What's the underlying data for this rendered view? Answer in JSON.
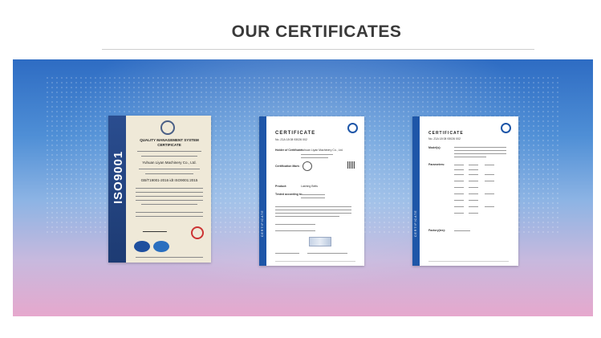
{
  "section": {
    "title": "OUR CERTIFICATES"
  },
  "certificates": [
    {
      "name": "iso-9001",
      "side_text": "ISO9001",
      "heading": "QUALITY MANAGEMENT SYSTEM",
      "subheading": "CERTIFICATE",
      "company": "Yuhuan Liyan Machinery Co., Ltd.",
      "standard": "GB/T19001-2016 idt ISO9001:2015"
    },
    {
      "name": "tuv-certificate-1",
      "side_text": "CERTIFICATE",
      "heading": "CERTIFICATE",
      "number": "No. Z1A 18 08 93026 002",
      "holder_label": "Holder of Certificate:",
      "holder": "Yuhuan Liyan Machinery Co., Ltd.",
      "mark_label": "Certification Mark:",
      "product_label": "Product:",
      "product": "Lashing Belts",
      "tested_label": "Tested according to:"
    },
    {
      "name": "tuv-certificate-2",
      "side_text": "CERTIFICATE",
      "heading": "CERTIFICATE",
      "number": "No. Z1A 18 08 93026 002",
      "models_label": "Model(s):",
      "parameters_label": "Parameters:",
      "factory_label": "Factory(ies):"
    }
  ]
}
